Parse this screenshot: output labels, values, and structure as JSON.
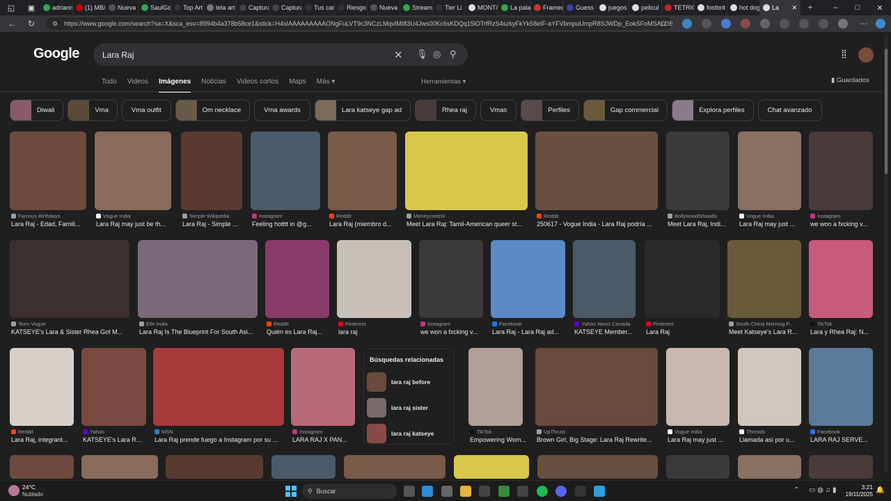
{
  "tabs": [
    "adriann",
    "(1) MB/",
    "Nueva",
    "SaulGo",
    "Top Art",
    "tela art",
    "Captura",
    "Captura",
    "Tus can",
    "Riesgo",
    "Nueva",
    "Stream",
    "Tier Li",
    "MONT/",
    "La pala",
    "Framed",
    "Guess T",
    "juegos",
    "pelicul",
    "TETRIO",
    "fosforit",
    "hot dog",
    "La"
  ],
  "address": "https://www.google.com/search?sa=X&sca_esv=8994b4a378b58ce1&stick=H4sIAAAAAAAAAONgFuLVT9c3NCzLMqvIMI83U4Jws00Kc6sKDQq15lOTrfRzS4szkyFkYk58eIF-aYFVbmpuUmpR8SJWDp_EokSFoMSALDBUy8...",
  "google_logo": "Google",
  "search": {
    "query": "Lara Raj"
  },
  "search_tabs": [
    "Todo",
    "Videos",
    "Imágenes",
    "Noticias",
    "Videos cortos",
    "Maps",
    "Más ▾"
  ],
  "tools_label": "Herramientas ▾",
  "saved_label": "Guardados",
  "chips": [
    "Diwali",
    "Vma",
    "Vma outfit",
    "Om necklace",
    "Vma awards",
    "Lara katseye gap ad",
    "Rhea raj",
    "Vmas",
    "Perfiles",
    "Gap commercial",
    "Explora perfiles",
    "Chat avanzado"
  ],
  "row1": [
    {
      "src": "Famous Birthdays",
      "cap": "Lara Raj - Edad, Famili..."
    },
    {
      "src": "Vogue India",
      "cap": "Lara Raj may just be th..."
    },
    {
      "src": "Simple Wikipedia",
      "cap": "Lara Raj - Simple ..."
    },
    {
      "src": "Instagram",
      "cap": "Feeling hotttt in @g..."
    },
    {
      "src": "Reddit",
      "cap": "Lara Raj (miembro d..."
    },
    {
      "src": "Moneycontrol",
      "cap": "Meet Lara Raj: Tamil-American queer st..."
    },
    {
      "src": "Reddit",
      "cap": "250617 - Vogue India - Lara Raj podría ..."
    },
    {
      "src": "BollywoodShaadis",
      "cap": "Meet Lara Raj, Indi..."
    },
    {
      "src": "Vogue India",
      "cap": "Lara Raj may just ..."
    },
    {
      "src": "Instagram",
      "cap": "we won a fxcking v..."
    }
  ],
  "row2": [
    {
      "src": "Teen Vogue",
      "cap": "KATSEYE's Lara & Sister Rhea Got M..."
    },
    {
      "src": "Elle India",
      "cap": "Lara Raj Is The Blueprint For South Asi..."
    },
    {
      "src": "Reddit",
      "cap": "Quién es Lara Raj..."
    },
    {
      "src": "Pinterest",
      "cap": "lara raj"
    },
    {
      "src": "Instagram",
      "cap": "we won a fxcking v..."
    },
    {
      "src": "Facebook",
      "cap": "Lara Raj - Lara Raj ad..."
    },
    {
      "src": "Yahoo News Canada",
      "cap": "KATSEYE Member..."
    },
    {
      "src": "Pinterest",
      "cap": "Lara Raj"
    },
    {
      "src": "South China Morning P...",
      "cap": "Meet Katseye's Lara R..."
    },
    {
      "src": "TikTok",
      "cap": "Lara y Rhea Raj: N..."
    }
  ],
  "row3": [
    {
      "src": "Reddit",
      "cap": "Lara Raj, integrant..."
    },
    {
      "src": "Yahoo",
      "cap": "KATSEYE's Lara R..."
    },
    {
      "src": "MSN",
      "cap": "Lara Raj prende fuego a Instagram por su ..."
    },
    {
      "src": "Instagram",
      "cap": "LARA RAJ X PAN..."
    },
    {
      "src": "TikTok",
      "cap": "Empowering Wom..."
    },
    {
      "src": "UpThrust",
      "cap": "Brown Girl, Big Stage: Lara Raj Rewrite..."
    },
    {
      "src": "Vogue India",
      "cap": "Lara Raj may just ..."
    },
    {
      "src": "Threads",
      "cap": "Llamada así por u..."
    },
    {
      "src": "Facebook",
      "cap": "LARA RAJ SERVE..."
    }
  ],
  "related": {
    "title": "Búsquedas relacionadas",
    "items": [
      "lara raj before",
      "lara raj sister",
      "lara raj katseye"
    ]
  },
  "taskbar": {
    "temp": "24°C",
    "weather": "Nublado",
    "search": "Buscar",
    "time": "3:21",
    "date": "19/11/2025"
  }
}
